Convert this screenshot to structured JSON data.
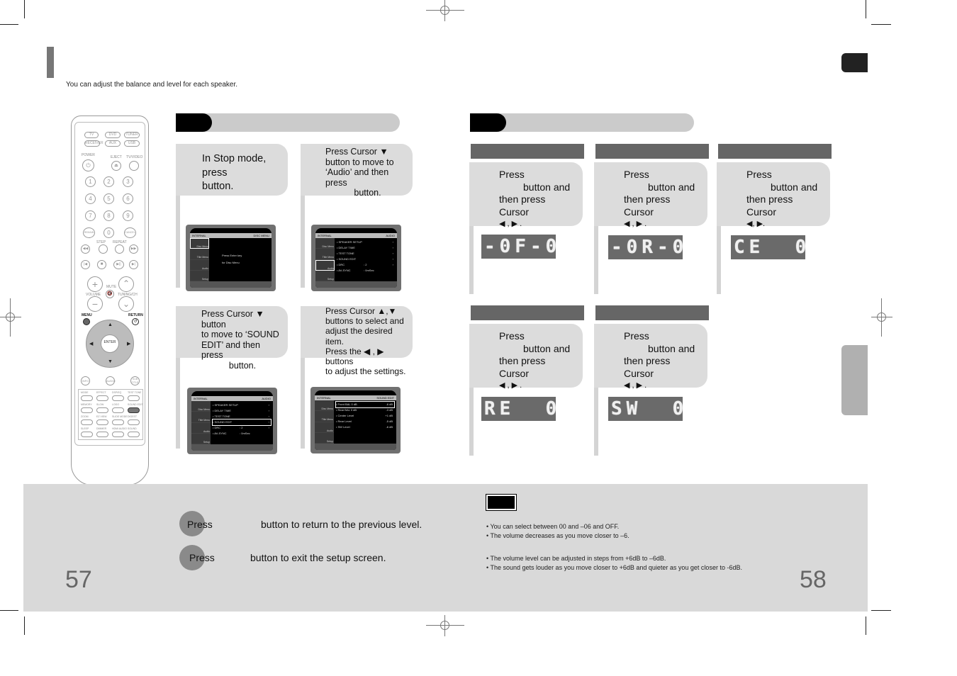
{
  "header": {
    "subtitle": "You can adjust the balance and level for each speaker."
  },
  "remote": {
    "source_buttons": [
      "TV",
      "DVD",
      "TUNER",
      "RECEIVER",
      "AUX",
      "USB"
    ],
    "labels": {
      "power": "POWER",
      "eject": "EJECT",
      "tv_video": "TV/VIDEO",
      "step": "STEP",
      "repeat": "REPEAT",
      "volume": "VOLUME",
      "mute": "MUTE",
      "tuning": "TUNING/CH",
      "menu": "MENU",
      "return": "RETURN",
      "enter": "ENTER",
      "remain": "REMAIN",
      "cancel": "CANCEL",
      "info": "INFO",
      "audio": "AUDIO",
      "subtitle": "SUB TITLE"
    },
    "numbers": [
      "1",
      "2",
      "3",
      "4",
      "5",
      "6",
      "7",
      "8",
      "9",
      "0"
    ],
    "function_rows": [
      [
        "MODE",
        "EFFECT",
        "DSP/EQ",
        "TEST TONE"
      ],
      [
        "MEMORY",
        "SLOW",
        "LOGO",
        "SOUND EDIT"
      ],
      [
        "ZOOM",
        "EZ VIEW",
        "SLIDE MODE",
        "DIGEST"
      ],
      [
        "SLEEP",
        "DIMMER",
        "HDMI AUDIO",
        "SOUND"
      ]
    ],
    "highlighted_button": "SOUND EDIT"
  },
  "left_steps": [
    {
      "lines": [
        "In Stop mode,",
        "press",
        "button."
      ],
      "osd": {
        "title_left": "INTERNAL",
        "title_right": "DISC MENU",
        "side": [
          "Disc Menu",
          "Title Menu",
          "Audio",
          "Setup"
        ],
        "side_selected": 0,
        "message": [
          "Press Enter key",
          "for Disc Menu"
        ]
      }
    },
    {
      "lines": [
        "Press Cursor ▼",
        "button to move to",
        "‘Audio’ and then press",
        "button."
      ],
      "osd": {
        "title_left": "INTERNAL",
        "title_right": "AUDIO",
        "side": [
          "Disc Menu",
          "Title Menu",
          "Audio",
          "Setup"
        ],
        "side_selected": 2,
        "items": [
          {
            "label": "SPEAKER SETUP",
            "value": "",
            "chev": "›"
          },
          {
            "label": "DELAY TIME",
            "value": "",
            "chev": "›"
          },
          {
            "label": "TEST TONE",
            "value": "",
            "chev": "›"
          },
          {
            "label": "SOUND EDIT",
            "value": "",
            "chev": "›"
          },
          {
            "label": "DRC",
            "value": ": 2",
            "chev": "›"
          },
          {
            "label": "AV-SYNC",
            "value": ": 0mSec",
            "chev": ""
          }
        ]
      }
    },
    {
      "lines": [
        "Press Cursor ▼ button",
        "to move to ‘SOUND",
        "EDIT’ and then press",
        "button."
      ],
      "osd": {
        "title_left": "INTERNAL",
        "title_right": "AUDIO",
        "side": [
          "Disc Menu",
          "Title Menu",
          "Audio",
          "Setup"
        ],
        "side_selected": -1,
        "items": [
          {
            "label": "SPEAKER SETUP",
            "value": "",
            "chev": "›"
          },
          {
            "label": "DELAY TIME",
            "value": "",
            "chev": "›"
          },
          {
            "label": "TEST TONE",
            "value": "",
            "chev": "›"
          },
          {
            "label": "SOUND EDIT",
            "value": "",
            "chev": "›",
            "selected": true
          },
          {
            "label": "DRC",
            "value": ": 2",
            "chev": "›"
          },
          {
            "label": "AV-SYNC",
            "value": ": 0mSec",
            "chev": ""
          }
        ]
      }
    },
    {
      "lines": [
        "Press Cursor  ▲,▼",
        "buttons to select and",
        "adjust the desired item.",
        "Press the  ◀ , ▶  buttons",
        "to adjust the settings."
      ],
      "osd": {
        "title_left": "INTERNAL",
        "title_right": "SOUND EDIT",
        "side": [
          "Disc Menu",
          "Title Menu",
          "Audio",
          "Setup"
        ],
        "side_selected": -1,
        "items": [
          {
            "label": "Front BAL  0 dB",
            "value": "",
            "chev": "-6 dB",
            "selected": true
          },
          {
            "label": "Rear BAL  0 dB",
            "value": "",
            "chev": "-3 dB"
          },
          {
            "label": "Center Level",
            "value": "",
            "chev": "+1 dB"
          },
          {
            "label": "Rear Level",
            "value": "",
            "chev": "-5 dB"
          },
          {
            "label": "SW  Level",
            "value": "",
            "chev": "-6 dB"
          }
        ]
      }
    }
  ],
  "speaker_steps": [
    {
      "lines": [
        "Press",
        "button and",
        "then press Cursor",
        "◀ , ▶ ."
      ],
      "display": "-0F-0"
    },
    {
      "lines": [
        "Press",
        "button and",
        "then press Cursor",
        "◀ , ▶ ."
      ],
      "display": "-0R-0"
    },
    {
      "lines": [
        "Press",
        "button and",
        "then press Cursor",
        "◀, ▶."
      ],
      "display": "CE  0"
    },
    {
      "lines": [
        "Press",
        "button and",
        "then press Cursor",
        "◀ , ▶ ."
      ],
      "display": "RE  0"
    },
    {
      "lines": [
        "Press",
        "button and",
        "then press Cursor",
        "◀ , ▶ ."
      ],
      "display": "SW  0"
    }
  ],
  "bottom": {
    "return_press": "Press",
    "return_text": "button to return to the previous level.",
    "exit_press": "Press",
    "exit_text": "button to exit the setup screen.",
    "notes_group1": [
      "You can select between 00 and –06 and OFF.",
      "The volume decreases as you move closer to –6."
    ],
    "notes_group2": [
      "The volume level can be adjusted in steps from +6dB to –6dB.",
      "The sound gets louder as you move closer to +6dB and quieter as you get closer to -6dB."
    ],
    "page_left": "57",
    "page_right": "58"
  }
}
